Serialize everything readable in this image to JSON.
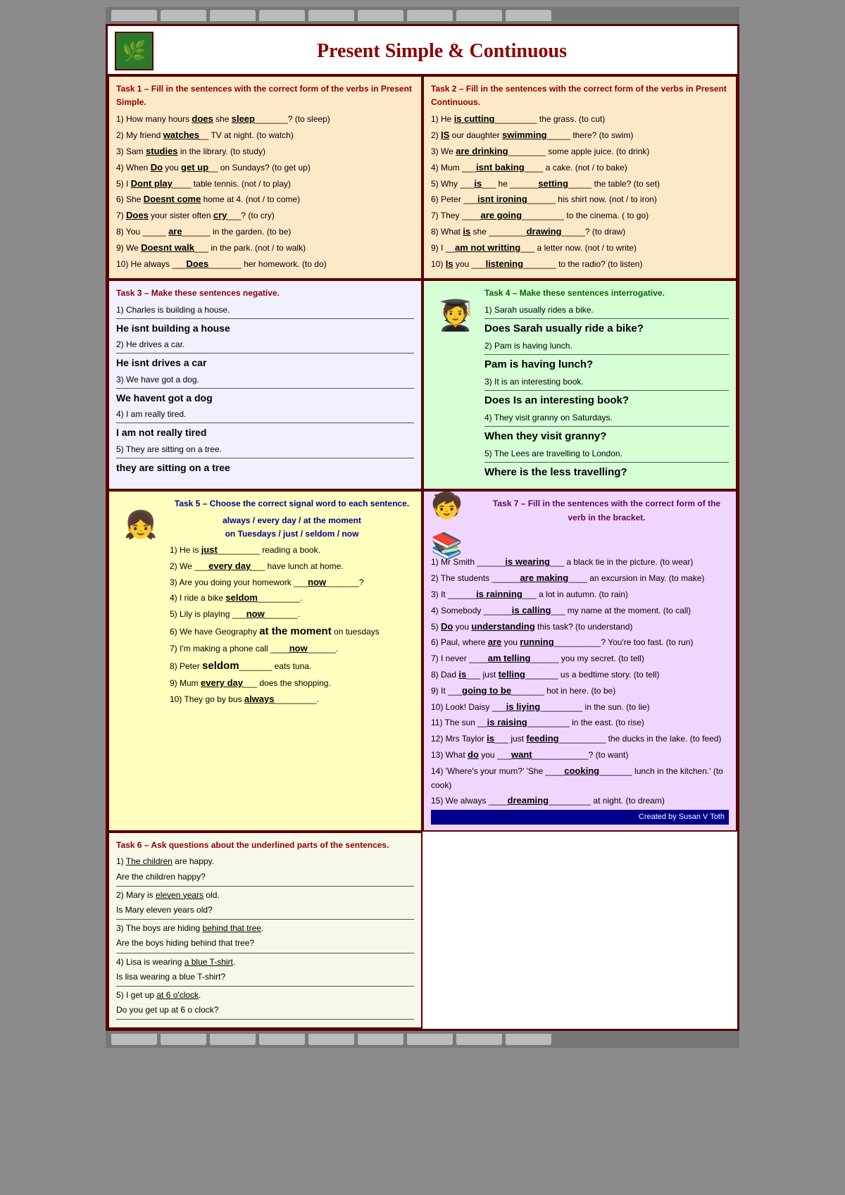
{
  "header": {
    "title": "Present Simple & Continuous",
    "logo_text": "🌿"
  },
  "task1": {
    "title": "Task 1 – Fill in the sentences with the correct form of the verbs in Present Simple.",
    "rows": [
      "1) How many hours __does__ she __sleep__________? (to sleep)",
      "2) My friend __watches___ TV at night. (to watch)",
      "3) Sam __studies__ in the library. (to study)",
      "4) When __Do__ you __get up____ on Sundays? (to get up)",
      "5) I ___Dont play____ table tennis. (not / to play)",
      "6) She __Doesnt come__ home at 4. (not / to come)",
      "7) __Does__ your sister often __cry______? (to cry)",
      "8) You ______are_______ in the garden. (to be)",
      "9) We __Doesnt walk___ in the park. (not / to walk)",
      "10) He always ______Does________ her homework. (to do)"
    ]
  },
  "task2": {
    "title": "Task 2 – Fill in the sentences with the correct form of the verbs in Present Continuous.",
    "rows": [
      "1) He __is cutting__________ the grass. (to cut)",
      "2) __IS__ our daughter __swimming_______ there? (to swim)",
      "3) We __are drinking_________ some apple juice. (to drink)",
      "4) Mum ____isnt baking____ a cake. (not / to bake)",
      "5) Why ___is___ he ______setting_____ the table? (to set)",
      "6) Peter ___isnt ironing________ his shirt now. (not / to iron)",
      "7) They ____are going__________ to the cinema. ( to go)",
      "8) What __is___ she ________drawing_______? (to draw)",
      "9) I ___am not writting___ a letter now. (not / to write)",
      "10) __Is__ you ___listening________ to the radio? (to listen)"
    ]
  },
  "task3": {
    "title": "Task 3 – Make these sentences negative.",
    "items": [
      {
        "original": "1) Charles is building a house.",
        "answer": "He isnt building a house"
      },
      {
        "original": "2) He drives a car.",
        "answer": "He isnt drives a car"
      },
      {
        "original": "3) We have got a dog.",
        "answer": "We havent got a dog"
      },
      {
        "original": "4) I am really tired.",
        "answer": "I am not really tired"
      },
      {
        "original": "5) They are sitting on a tree.",
        "answer": "they are sitting on a tree"
      }
    ]
  },
  "task4": {
    "title": "Task 4 – Make these sentences interrogative.",
    "items": [
      {
        "original": "1) Sarah usually rides a bike.",
        "answer": "Does Sarah usually ride a bike?"
      },
      {
        "original": "2) Pam is having lunch.",
        "answer": "Pam is having lunch?"
      },
      {
        "original": "3) It is an interesting book.",
        "answer": "Does Is an interesting book?"
      },
      {
        "original": "4) They visit granny on Saturdays.",
        "answer": "When they visit granny?"
      },
      {
        "original": "5) The Lees are travelling to London.",
        "answer": "Where is the less travelling?"
      }
    ]
  },
  "task5": {
    "title": "Task 5 – Choose the correct signal word to each sentence.",
    "signal_words": "always / every day / at the moment on Tuesdays / just / seldom / now",
    "rows": [
      "1) He is __just_________ reading a book.",
      "2) We ___every day___ have lunch at home.",
      "3) Are you doing your homework ___now________?",
      "4) I ride a bike __seldom_________.",
      "5) Lily is playing ___now_______.",
      "6) We have Geography __at the moment__ on tuesdays",
      "7) I'm making a phone call ______now______.",
      "8) Peter __seldom________ eats tuna.",
      "9) Mum __every day___ does the shopping.",
      "10) They go by bus __always_________."
    ]
  },
  "task6": {
    "title": "Task 6 – Ask questions about the underlined parts of the sentences.",
    "items": [
      {
        "original": "1) The children are happy.",
        "answer": "Are the children happy?"
      },
      {
        "original": "2) Mary is eleven years old.",
        "answer": "Is Mary eleven years old?"
      },
      {
        "original": "3) The boys are hiding behind that tree.",
        "answer": "Are the boys hiding behind that tree?"
      },
      {
        "original": "4) Lisa is wearing a blue T-shirt.",
        "answer": "Is lisa wearing a blue T-shirt?"
      },
      {
        "original": "5) I get up at 6 o'clock.",
        "answer": "Do you get up at 6 o clock?"
      }
    ]
  },
  "task7": {
    "title": "Task 7 – Fill in the sentences with the correct form of the verb in the bracket.",
    "rows": [
      "1) Mr Smith ______is wearing___ a black tie in the picture. (to wear)",
      "2) The students ______are making____ an excursion in May. (to make)",
      "3) It ______is rainning___ a lot in autumn. (to rain)",
      "4) Somebody ______is calling___ my name at the moment. (to call)",
      "5) __Do__ you __understanding__ this task? (to understand)",
      "6) Paul, where __are__ you __running__________? You're too fast. (to run)",
      "7) I never ____am telling______ you my secret. (to tell)",
      "8) Dad __is___ just __telling_______ us a bedtime story. (to tell)",
      "9) It ___going to be_______ hot in here. (to be)",
      "10) Look! Daisy ___is liying_________ in the sun. (to lie)",
      "11) The sun __is raising_________ in the east. (to rise)",
      "12) Mrs Taylor __is___ just __feeding__________ the ducks in the lake. (to feed)",
      "13) What __do__ you ___want____________? (to want)",
      "14) 'Where's your mum?' 'She ____cooking_______ lunch in the kitchen.' (to cook)",
      "15) We always ____dreaming_________ at night. (to dream)"
    ]
  },
  "footer": {
    "credit": "Created by Susan V Toth"
  }
}
